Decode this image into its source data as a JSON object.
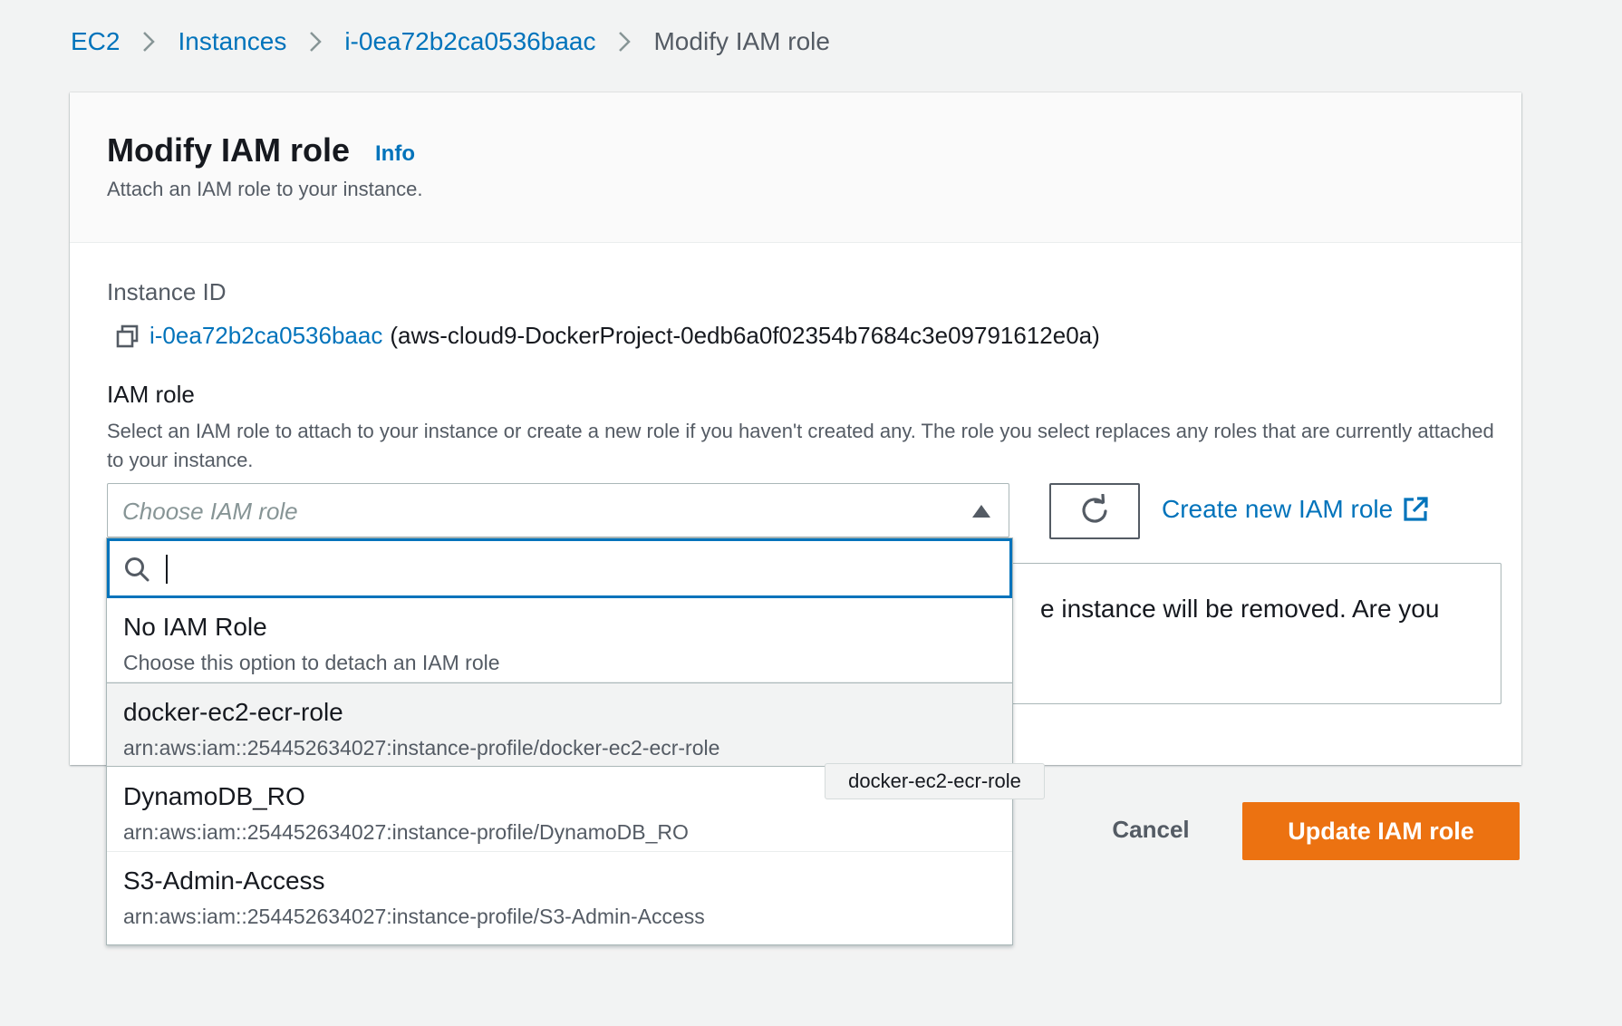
{
  "breadcrumb": {
    "items": [
      {
        "label": "EC2"
      },
      {
        "label": "Instances"
      },
      {
        "label": "i-0ea72b2ca0536baac"
      },
      {
        "label": "Modify IAM role"
      }
    ]
  },
  "header": {
    "title": "Modify IAM role",
    "info_label": "Info",
    "description": "Attach an IAM role to your instance."
  },
  "instance": {
    "label": "Instance ID",
    "id": "i-0ea72b2ca0536baac",
    "name": "(aws-cloud9-DockerProject-0edb6a0f02354b7684c3e09791612e0a)"
  },
  "iam_role": {
    "label": "IAM role",
    "description": "Select an IAM role to attach to your instance or create a new role if you haven't created any. The role you select replaces any roles that are currently attached to your instance.",
    "placeholder": "Choose IAM role",
    "search_value": "",
    "create_link_label": "Create new IAM role",
    "options": [
      {
        "label": "No IAM Role",
        "description": "Choose this option to detach an IAM role"
      },
      {
        "label": "docker-ec2-ecr-role",
        "description": "arn:aws:iam::254452634027:instance-profile/docker-ec2-ecr-role"
      },
      {
        "label": "DynamoDB_RO",
        "description": "arn:aws:iam::254452634027:instance-profile/DynamoDB_RO"
      },
      {
        "label": "S3-Admin-Access",
        "description": "arn:aws:iam::254452634027:instance-profile/S3-Admin-Access"
      }
    ],
    "tooltip": "docker-ec2-ecr-role"
  },
  "warning": {
    "visible_text": "e instance will be removed. Are you"
  },
  "actions": {
    "cancel_label": "Cancel",
    "update_label": "Update IAM role"
  },
  "colors": {
    "link": "#0073bb",
    "primary_button": "#ec7211",
    "focus_border": "#0073bb"
  }
}
